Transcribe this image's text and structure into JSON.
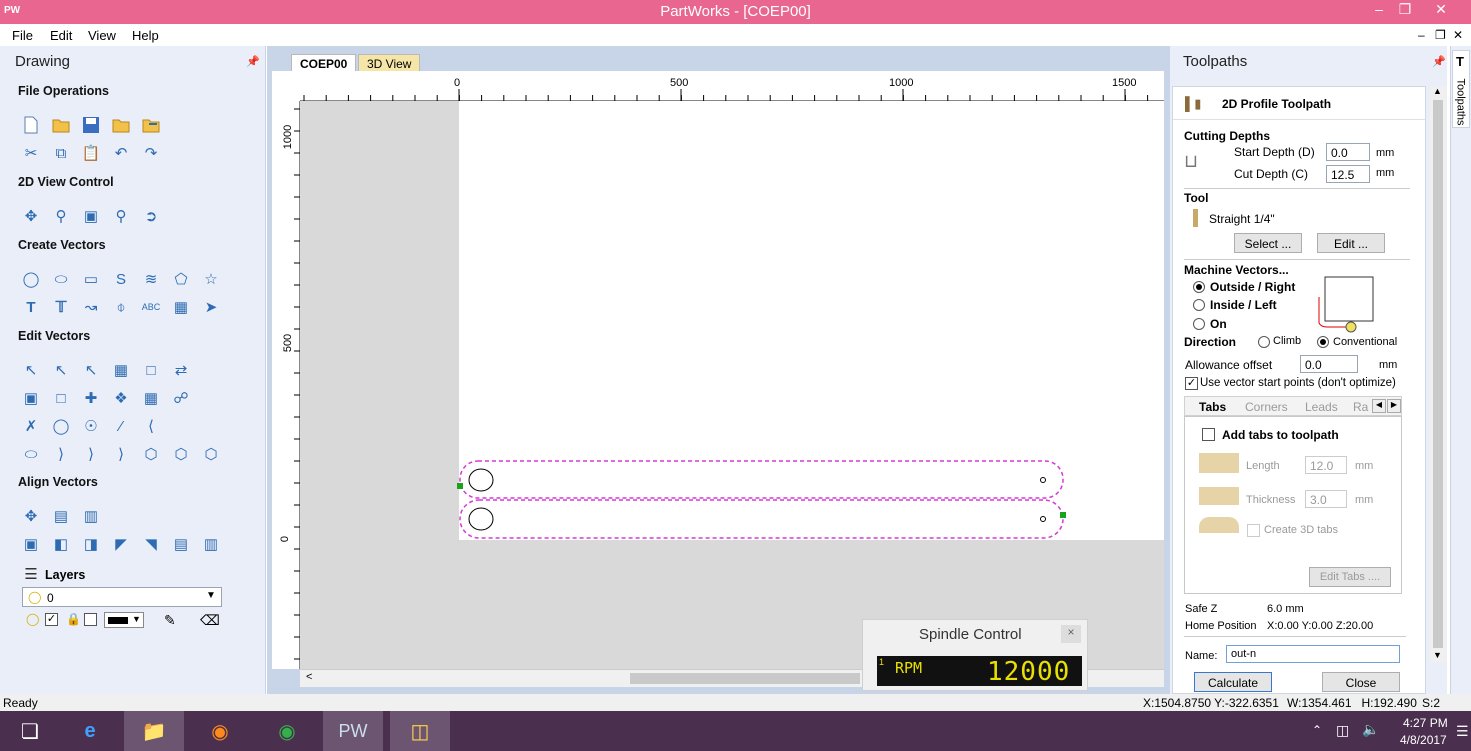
{
  "window": {
    "app_icon": "PW",
    "title": "PartWorks - [COEP00]"
  },
  "menu": [
    "File",
    "Edit",
    "View",
    "Help"
  ],
  "left_panel": {
    "title": "Drawing",
    "sections": {
      "file_ops": "File Operations",
      "view_ctrl": "2D View Control",
      "create": "Create Vectors",
      "edit": "Edit Vectors",
      "align": "Align Vectors"
    },
    "layers": {
      "label": "Layers",
      "selected": "0"
    }
  },
  "doc_tabs": [
    "COEP00",
    "3D View"
  ],
  "ruler": {
    "top_ticks": [
      "0",
      "500",
      "1000",
      "1500"
    ],
    "left_ticks": [
      "1000",
      "500",
      "0"
    ]
  },
  "spindle": {
    "title": "Spindle Control",
    "close": "×",
    "rpm_label": "RPM",
    "rpm_index": "1",
    "rpm_value": "12000"
  },
  "right_panel": {
    "title": "Toolpaths",
    "toolpath_name": "2D Profile Toolpath",
    "cutting_depths": {
      "header": "Cutting Depths",
      "start_label": "Start Depth (D)",
      "start_value": "0.0",
      "start_unit": "mm",
      "cut_label": "Cut Depth (C)",
      "cut_value": "12.5",
      "cut_unit": "mm"
    },
    "tool": {
      "header": "Tool",
      "name": "Straight 1/4\"",
      "select_btn": "Select ...",
      "edit_btn": "Edit ..."
    },
    "machine_vectors": {
      "header": "Machine Vectors...",
      "options": [
        "Outside / Right",
        "Inside / Left",
        "On"
      ],
      "selected_index": 0
    },
    "direction": {
      "label": "Direction",
      "climb": "Climb",
      "conventional": "Conventional",
      "selected": "Conventional"
    },
    "allowance": {
      "label": "Allowance offset",
      "value": "0.0",
      "unit": "mm"
    },
    "start_points": {
      "label": "Use vector start points (don't optimize)",
      "checked": true
    },
    "subtabs": [
      "Tabs",
      "Corners",
      "Leads",
      "Ra"
    ],
    "tabs_panel": {
      "add_label": "Add tabs to toolpath",
      "length_label": "Length",
      "length_value": "12.0",
      "length_unit": "mm",
      "thickness_label": "Thickness",
      "thickness_value": "3.0",
      "thickness_unit": "mm",
      "create3d_label": "Create 3D tabs",
      "edit_btn": "Edit Tabs ...."
    },
    "safe_z": {
      "label": "Safe Z",
      "value": "6.0 mm"
    },
    "home": {
      "label": "Home Position",
      "value": "X:0.00 Y:0.00 Z:20.00"
    },
    "name": {
      "label": "Name:",
      "value": "out-n"
    },
    "calculate_btn": "Calculate",
    "close_btn": "Close"
  },
  "vertical_tab": "Toolpaths",
  "status": {
    "left": "Ready",
    "coords": "X:1504.8750 Y:-322.6351",
    "size": "W:1354.461   H:192.490",
    "sel": "S:2"
  },
  "taskbar": {
    "time": "4:27 PM",
    "date": "4/8/2017",
    "pw_label": "PW"
  },
  "colors": {
    "titlebar": "#e8668f",
    "panel": "#e9eef8",
    "taskbar": "#4a2f4e",
    "toolpath_outline": "#d63ad6",
    "rpm_text": "#e8e000"
  }
}
